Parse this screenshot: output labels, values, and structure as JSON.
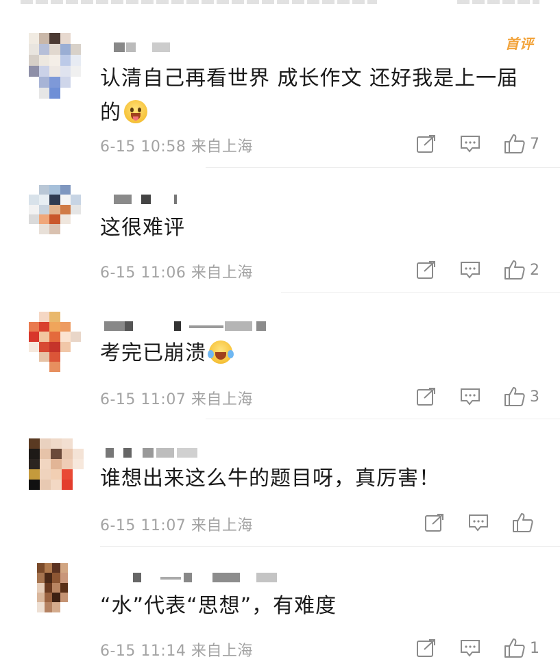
{
  "comments": [
    {
      "text_line1": "认清自己再看世界 成长作文 还好我是上一届",
      "text_line2": "的",
      "emoji": "tongue-out-emoji",
      "badge": "首评",
      "date": "6-15 10:58",
      "location": "来自上海",
      "likes": "7"
    },
    {
      "text_line1": "这很难评",
      "date": "6-15 11:06",
      "location": "来自上海",
      "likes": "2"
    },
    {
      "text_line1": "考完已崩溃",
      "emoji": "laugh-cry-emoji",
      "date": "6-15 11:07",
      "location": "来自上海",
      "likes": "3"
    },
    {
      "text_line1": "谁想出来这么牛的题目呀，真厉害！",
      "date": "6-15 11:07",
      "location": "来自上海",
      "likes": ""
    },
    {
      "text_line1": "“水”代表“思想”，有难度",
      "date": "6-15 11:14",
      "location": "来自上海",
      "likes": "1"
    }
  ],
  "icons": {
    "share": "share-icon",
    "reply": "comment-icon",
    "like": "thumbs-up-icon"
  },
  "colors": {
    "badge": "#f2a33a",
    "meta": "#a3a3a3",
    "icon": "#8a8a8a"
  }
}
